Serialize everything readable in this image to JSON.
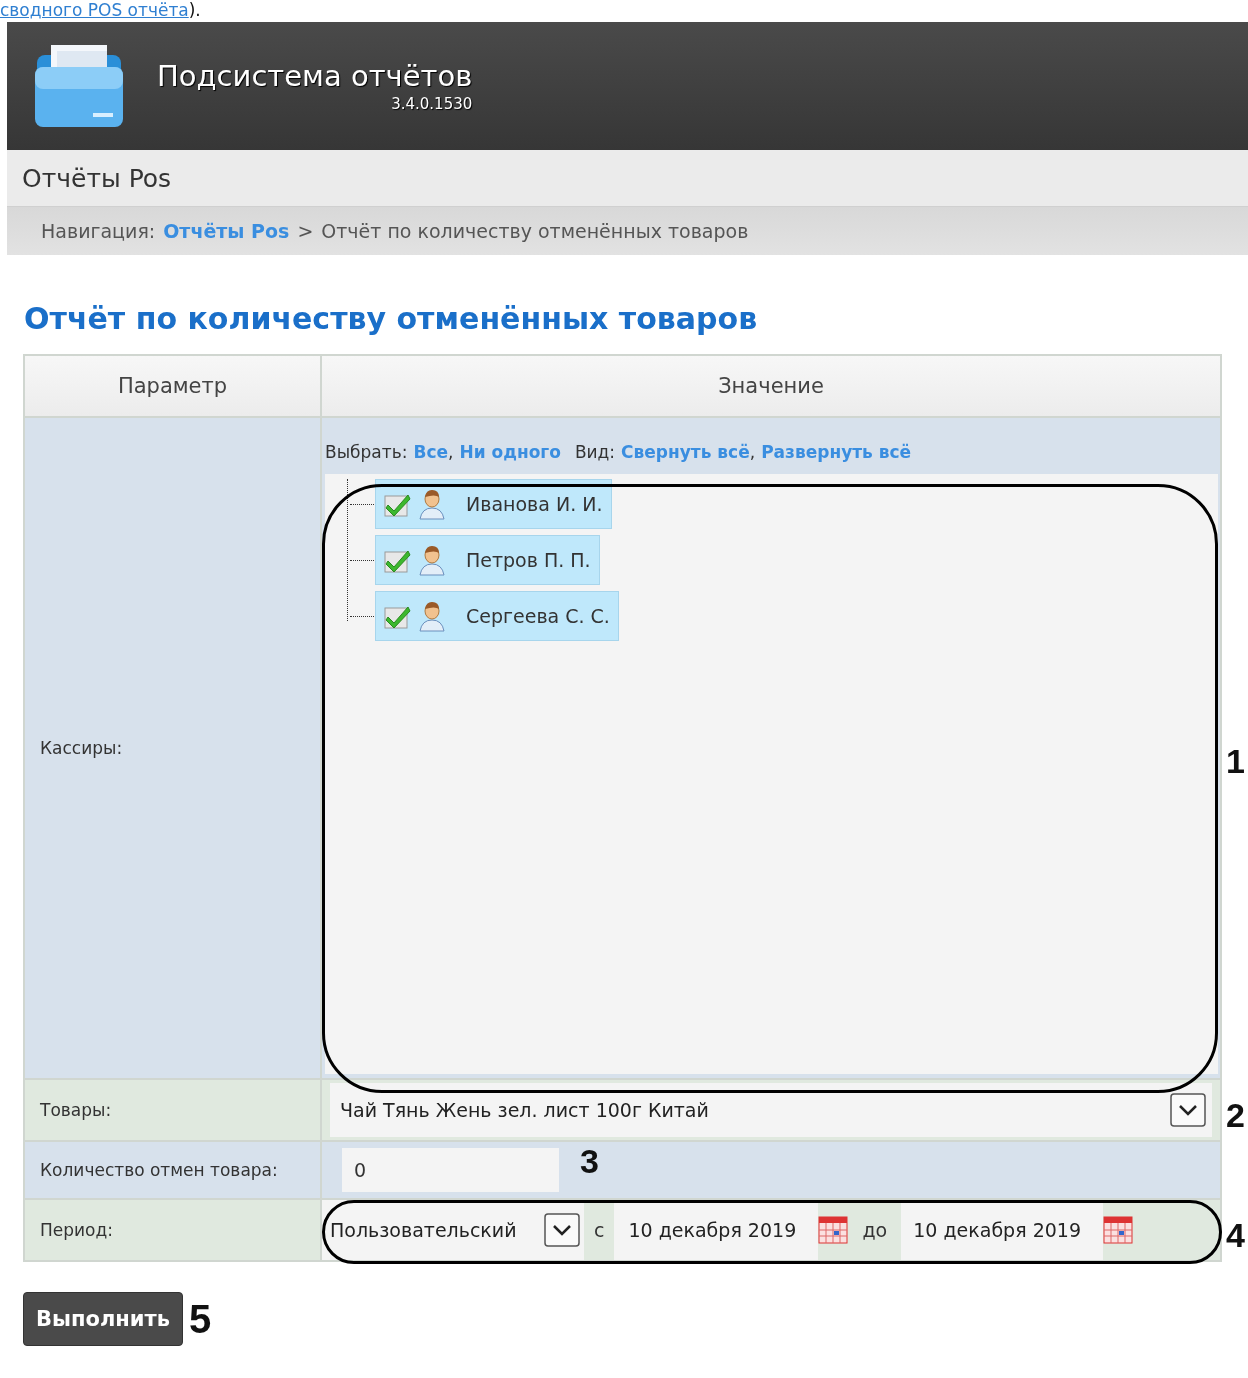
{
  "top_note": {
    "link": "сводного POS отчёта",
    "after": ")."
  },
  "header": {
    "title": "Подсистема отчётов",
    "version": "3.4.0.1530"
  },
  "section": {
    "title": "Отчёты Pos"
  },
  "breadcrumb": {
    "label": "Навигация:",
    "link": "Отчёты Pos",
    "separator": ">",
    "current": "Отчёт по количеству отменённых товаров"
  },
  "report": {
    "title": "Отчёт по количеству отменённых товаров",
    "columns": [
      "Параметр",
      "Значение"
    ],
    "cashiers": {
      "label": "Кассиры:",
      "select_label": "Выбрать:",
      "select_links": [
        "Все",
        "Ни одного"
      ],
      "view_label": "Вид:",
      "view_links": [
        "Свернуть всё",
        "Развернуть всё"
      ],
      "separator": ",",
      "items": [
        {
          "name": "Иванова И. И.",
          "checked": true
        },
        {
          "name": "Петров П. П.",
          "checked": true
        },
        {
          "name": "Сергеева С. С.",
          "checked": true
        }
      ]
    },
    "goods": {
      "label": "Товары:",
      "value": "Чай Тянь Жень зел. лист 100г Китай"
    },
    "cancel_count": {
      "label": "Количество отмен товара:",
      "value": "0"
    },
    "period": {
      "label": "Период:",
      "type": "Пользовательский",
      "from_label": "с",
      "from": "10 декабря 2019",
      "to_label": "до",
      "to": "10 декабря 2019"
    },
    "run_button": "Выполнить"
  },
  "annotations": [
    "1",
    "2",
    "3",
    "4",
    "5"
  ]
}
